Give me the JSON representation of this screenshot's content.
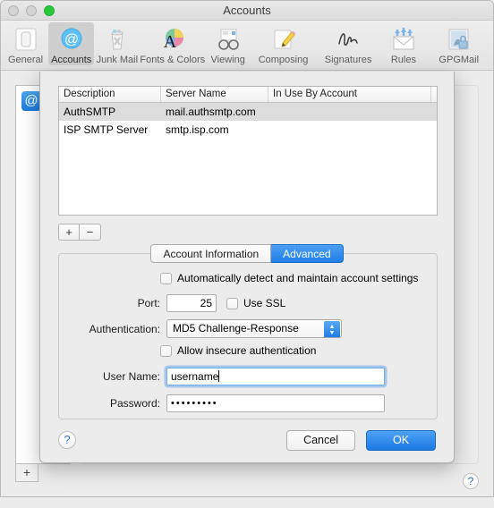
{
  "window": {
    "title": "Accounts",
    "traffic_lights": [
      "close",
      "minimize",
      "zoom"
    ],
    "toolbar": [
      {
        "label": "General",
        "icon": "general-icon"
      },
      {
        "label": "Accounts",
        "icon": "at-sign-icon",
        "selected": true
      },
      {
        "label": "Junk Mail",
        "icon": "trash-icon"
      },
      {
        "label": "Fonts & Colors",
        "icon": "font-color-icon"
      },
      {
        "label": "Viewing",
        "icon": "glasses-icon"
      },
      {
        "label": "Composing",
        "icon": "pencil-note-icon"
      },
      {
        "label": "Signatures",
        "icon": "signature-icon"
      },
      {
        "label": "Rules",
        "icon": "rules-envelope-icon"
      },
      {
        "label": "GPGMail",
        "icon": "gpgmail-icon"
      }
    ],
    "background": {
      "add_account_label": "+",
      "help_label": "?"
    }
  },
  "sheet": {
    "table": {
      "columns": [
        "Description",
        "Server Name",
        "In Use By Account"
      ],
      "rows": [
        {
          "description": "AuthSMTP",
          "server": "mail.authsmtp.com",
          "in_use": "",
          "selected": true
        },
        {
          "description": "ISP SMTP Server",
          "server": "smtp.isp.com",
          "in_use": "",
          "selected": false
        }
      ]
    },
    "list_controls": {
      "add_label": "+",
      "remove_label": "−"
    },
    "tabs": [
      {
        "label": "Account Information",
        "active": false
      },
      {
        "label": "Advanced",
        "active": true
      }
    ],
    "form": {
      "auto_detect": {
        "label": "Automatically detect and maintain account settings",
        "checked": false
      },
      "port": {
        "label": "Port:",
        "value": "25"
      },
      "use_ssl": {
        "label": "Use SSL",
        "checked": false
      },
      "authentication": {
        "label": "Authentication:",
        "value": "MD5 Challenge-Response"
      },
      "allow_insecure": {
        "label": "Allow insecure authentication",
        "checked": false
      },
      "user_name": {
        "label": "User Name:",
        "value": "username",
        "focused": true
      },
      "password": {
        "label": "Password:",
        "value": "•••••••••"
      }
    },
    "footer": {
      "help_label": "?",
      "cancel_label": "Cancel",
      "ok_label": "OK"
    }
  },
  "colors": {
    "accent_blue": "#1d7ae4",
    "window_bg": "#ececec",
    "selection_gray": "#dcdcdc"
  }
}
